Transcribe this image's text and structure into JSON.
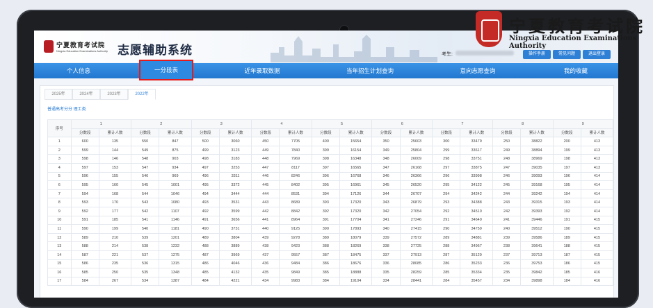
{
  "header": {
    "logo_name": "宁夏教育考试院",
    "logo_en": "Ningxia Education Examinations Authority",
    "title": "志愿辅助系统",
    "examinee_label": "考生:",
    "buttons": [
      "操作手册",
      "常见问题",
      "退出登录"
    ]
  },
  "nav": {
    "items": [
      "个人信息",
      "一分段表",
      "近年录取数据",
      "当年招生计划查询",
      "意向志愿查询",
      "我的收藏"
    ],
    "active_index": 1
  },
  "year_tabs": [
    "2025年",
    "2024年",
    "2023年",
    "2022年"
  ],
  "active_year_index": 3,
  "subject_label": "普通高考分分 理工类",
  "table": {
    "seq_header": "序号",
    "group_numbers": [
      "1",
      "2",
      "3",
      "4",
      "5",
      "6",
      "7",
      "8",
      "9"
    ],
    "score_header": "分数段",
    "cum_header": "累计人数",
    "rows": [
      [
        "1",
        "600",
        "135",
        "550",
        "847",
        "500",
        "3060",
        "450",
        "7705",
        "400",
        "15654",
        "350",
        "25603",
        "300",
        "33479",
        "250",
        "38822",
        "200",
        "413"
      ],
      [
        "2",
        "599",
        "144",
        "549",
        "875",
        "499",
        "3123",
        "449",
        "7840",
        "399",
        "16154",
        "349",
        "25804",
        "299",
        "33617",
        "249",
        "38894",
        "199",
        "413"
      ],
      [
        "3",
        "598",
        "146",
        "548",
        "903",
        "498",
        "3183",
        "448",
        "7969",
        "398",
        "16348",
        "348",
        "26009",
        "298",
        "33751",
        "248",
        "38969",
        "198",
        "413"
      ],
      [
        "4",
        "597",
        "153",
        "547",
        "934",
        "497",
        "3253",
        "447",
        "8117",
        "397",
        "16565",
        "347",
        "26168",
        "297",
        "33875",
        "247",
        "39035",
        "197",
        "413"
      ],
      [
        "5",
        "596",
        "155",
        "546",
        "969",
        "496",
        "3311",
        "446",
        "8246",
        "396",
        "16768",
        "346",
        "26366",
        "296",
        "33998",
        "246",
        "39093",
        "196",
        "414"
      ],
      [
        "6",
        "595",
        "160",
        "545",
        "1001",
        "495",
        "3372",
        "445",
        "8402",
        "395",
        "16961",
        "345",
        "26520",
        "295",
        "34122",
        "245",
        "39168",
        "195",
        "414"
      ],
      [
        "7",
        "594",
        "168",
        "544",
        "1046",
        "494",
        "3444",
        "444",
        "8531",
        "394",
        "17126",
        "344",
        "26707",
        "294",
        "34242",
        "244",
        "39242",
        "194",
        "414"
      ],
      [
        "8",
        "593",
        "170",
        "543",
        "1080",
        "493",
        "3531",
        "443",
        "8689",
        "393",
        "17320",
        "343",
        "26879",
        "293",
        "34388",
        "243",
        "39315",
        "193",
        "414"
      ],
      [
        "9",
        "592",
        "177",
        "542",
        "1107",
        "492",
        "3599",
        "442",
        "8842",
        "392",
        "17320",
        "342",
        "27054",
        "292",
        "34510",
        "242",
        "39393",
        "192",
        "414"
      ],
      [
        "10",
        "591",
        "185",
        "541",
        "1146",
        "491",
        "3656",
        "441",
        "8964",
        "391",
        "17704",
        "341",
        "27246",
        "291",
        "34640",
        "241",
        "39446",
        "191",
        "415"
      ],
      [
        "11",
        "590",
        "199",
        "540",
        "1181",
        "490",
        "3731",
        "440",
        "9125",
        "390",
        "17893",
        "340",
        "27415",
        "290",
        "34759",
        "240",
        "39512",
        "190",
        "415"
      ],
      [
        "12",
        "589",
        "210",
        "539",
        "1201",
        "489",
        "3804",
        "439",
        "9278",
        "389",
        "18079",
        "339",
        "27572",
        "289",
        "34881",
        "239",
        "39586",
        "189",
        "415"
      ],
      [
        "13",
        "588",
        "214",
        "538",
        "1232",
        "488",
        "3889",
        "438",
        "9423",
        "388",
        "18269",
        "338",
        "27725",
        "288",
        "34967",
        "238",
        "39641",
        "188",
        "415"
      ],
      [
        "14",
        "587",
        "221",
        "537",
        "1275",
        "487",
        "3969",
        "437",
        "9557",
        "387",
        "18475",
        "337",
        "27913",
        "287",
        "35129",
        "237",
        "39713",
        "187",
        "415"
      ],
      [
        "15",
        "586",
        "235",
        "536",
        "1315",
        "486",
        "4046",
        "436",
        "9484",
        "386",
        "18676",
        "336",
        "28085",
        "286",
        "35233",
        "236",
        "39753",
        "186",
        "415"
      ],
      [
        "16",
        "585",
        "250",
        "535",
        "1348",
        "485",
        "4132",
        "435",
        "9849",
        "385",
        "18888",
        "335",
        "28259",
        "285",
        "35334",
        "235",
        "39842",
        "185",
        "416"
      ],
      [
        "17",
        "584",
        "267",
        "534",
        "1387",
        "484",
        "4221",
        "434",
        "9983",
        "384",
        "19104",
        "334",
        "28441",
        "284",
        "35457",
        "234",
        "39898",
        "184",
        "416"
      ]
    ]
  },
  "watermark": {
    "cn": "宁夏教育考试院",
    "en": "Ningxia Education Examinations Authority"
  }
}
